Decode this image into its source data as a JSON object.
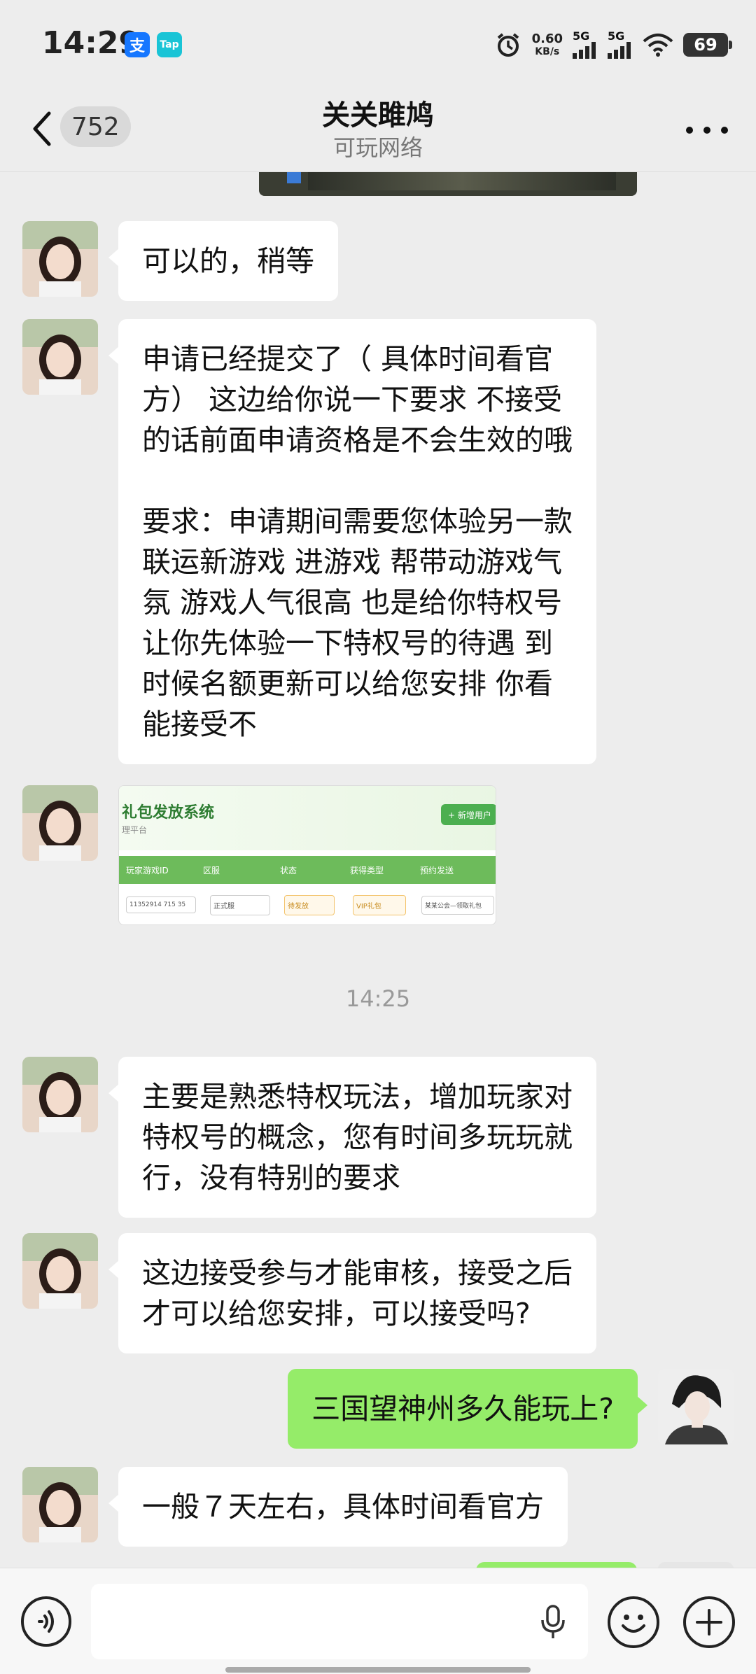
{
  "status_bar": {
    "time": "14:29",
    "app_badges": [
      "支",
      "Tap"
    ],
    "net_speed_value": "0.60",
    "net_speed_unit": "KB/s",
    "signal_label_1": "5G",
    "signal_label_2": "5G",
    "battery": "69"
  },
  "nav": {
    "unread_count": "752",
    "title": "关关雎鸠",
    "subtitle": "可玩网络"
  },
  "messages": [
    {
      "from": "left",
      "text": "可以的，稍等"
    },
    {
      "from": "left",
      "text": "申请已经提交了（ 具体时间看官\n方） 这边给你说一下要求 不接受\n的话前面申请资格是不会生效的哦\n\n要求：申请期间需要您体验另一款\n联运新游戏 进游戏 帮带动游戏气\n氛 游戏人气很高 也是给你特权号\n让你先体验一下特权号的待遇 到\n时候名额更新可以给您安排 你看\n能接受不"
    },
    {
      "from": "left",
      "type": "image",
      "image_title": "礼包发放系统",
      "image_subtitle": "理平台",
      "image_button": "+ 新增用户",
      "table_headers": [
        "玩家游戏ID",
        "区服",
        "状态",
        "获得类型",
        "预约发送"
      ],
      "table_row": [
        "11352914 715 35",
        "正式服",
        "待发放",
        "VIP礼包",
        "某某公会—领取礼包"
      ]
    },
    {
      "type": "timestamp",
      "text": "14:25"
    },
    {
      "from": "left",
      "text": "主要是熟悉特权玩法，增加玩家对\n特权号的概念，您有时间多玩玩就\n行，没有特别的要求"
    },
    {
      "from": "left",
      "text": "这边接受参与才能审核，接受之后\n才可以给您安排，可以接受吗?"
    },
    {
      "from": "right",
      "text": "三国望神州多久能玩上?"
    },
    {
      "from": "left",
      "text": "一般７天左右，具体时间看官方"
    }
  ],
  "colors": {
    "background": "#ededed",
    "bubble_self": "#95ec69",
    "bubble_other": "#ffffff"
  },
  "icons": [
    "back-chevron-icon",
    "more-dots-icon",
    "voice-icon",
    "mic-icon",
    "emoji-icon",
    "plus-icon",
    "alarm-icon",
    "wifi-icon",
    "signal-icon",
    "battery-icon"
  ]
}
